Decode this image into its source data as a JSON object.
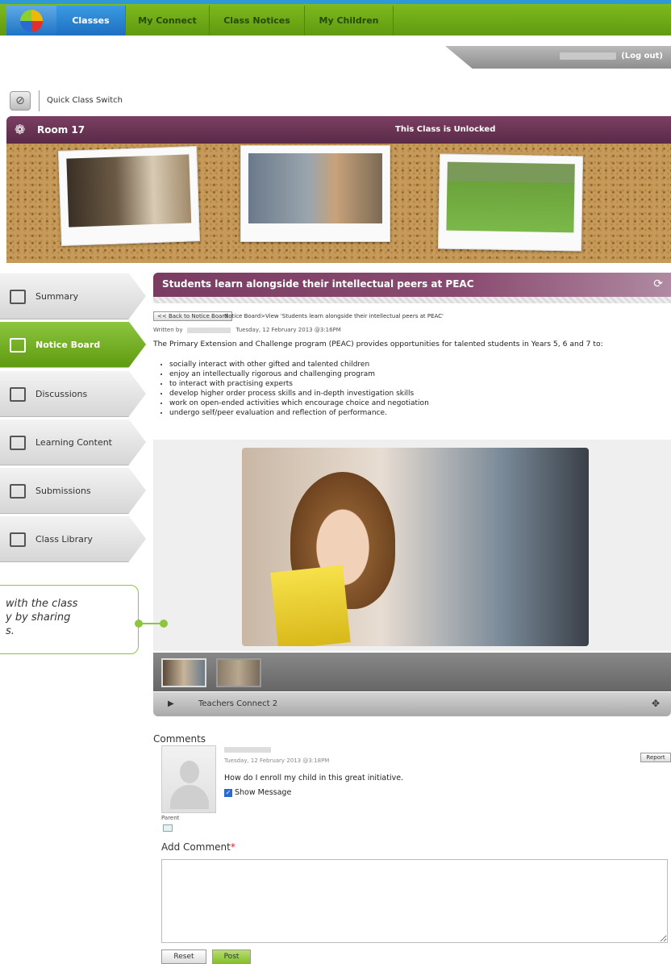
{
  "nav": {
    "tabs": [
      {
        "label": "Classes",
        "active": true
      },
      {
        "label": "My Connect",
        "active": false
      },
      {
        "label": "Class Notices",
        "active": false
      },
      {
        "label": "My Children",
        "active": false
      }
    ]
  },
  "user": {
    "logout_label": "(Log out)"
  },
  "quick_switch": {
    "label": "Quick Class Switch"
  },
  "room": {
    "name": "Room 17",
    "status": "This Class is Unlocked"
  },
  "sidebar": {
    "items": [
      {
        "label": "Summary",
        "icon": "document-icon",
        "active": false
      },
      {
        "label": "Notice Board",
        "icon": "megaphone-icon",
        "active": true
      },
      {
        "label": "Discussions",
        "icon": "speech-bubbles-icon",
        "active": false
      },
      {
        "label": "Learning Content",
        "icon": "monitor-icon",
        "active": false
      },
      {
        "label": "Submissions",
        "icon": "upload-icon",
        "active": false
      },
      {
        "label": "Class Library",
        "icon": "folder-icon",
        "active": false
      }
    ]
  },
  "article": {
    "title": "Students learn alongside their intellectual peers at PEAC",
    "back_label": "<< Back to Notice Board",
    "breadcrumb": "Notice Board>View 'Students learn alongside their intellectual peers at PEAC'",
    "written_by": "Written by",
    "date": "Tuesday, 12 February 2013 @3:16PM",
    "intro": "The Primary Extension and Challenge program (PEAC) provides opportunities for talented students in Years 5, 6 and 7 to:",
    "bullets": [
      "socially interact with other gifted and talented children",
      "enjoy an intellectually rigorous and challenging program",
      "to interact with practising experts",
      "develop higher order process skills and in-depth investigation skills",
      "work on open-ended activities which encourage choice and negotiation",
      "undergo self/peer evaluation and reflection of performance."
    ]
  },
  "player": {
    "title": "Teachers Connect 2"
  },
  "callout": {
    "text": "with the class\ny by sharing\ns."
  },
  "comments": {
    "heading": "Comments",
    "items": [
      {
        "date": "Tuesday, 12 February 2013 @3:18PM",
        "text": "How do I enroll my child in this great initiative.",
        "show_message_label": "Show Message",
        "role": "Parent",
        "report_label": "Report"
      }
    ]
  },
  "add_comment": {
    "label": "Add Comment",
    "required_mark": "*",
    "reset_label": "Reset",
    "post_label": "Post"
  },
  "colors": {
    "nav_green": "#6aa815",
    "nav_blue": "#1e6fc0",
    "room_purple": "#6a3354",
    "accent_green": "#8cc63f"
  }
}
